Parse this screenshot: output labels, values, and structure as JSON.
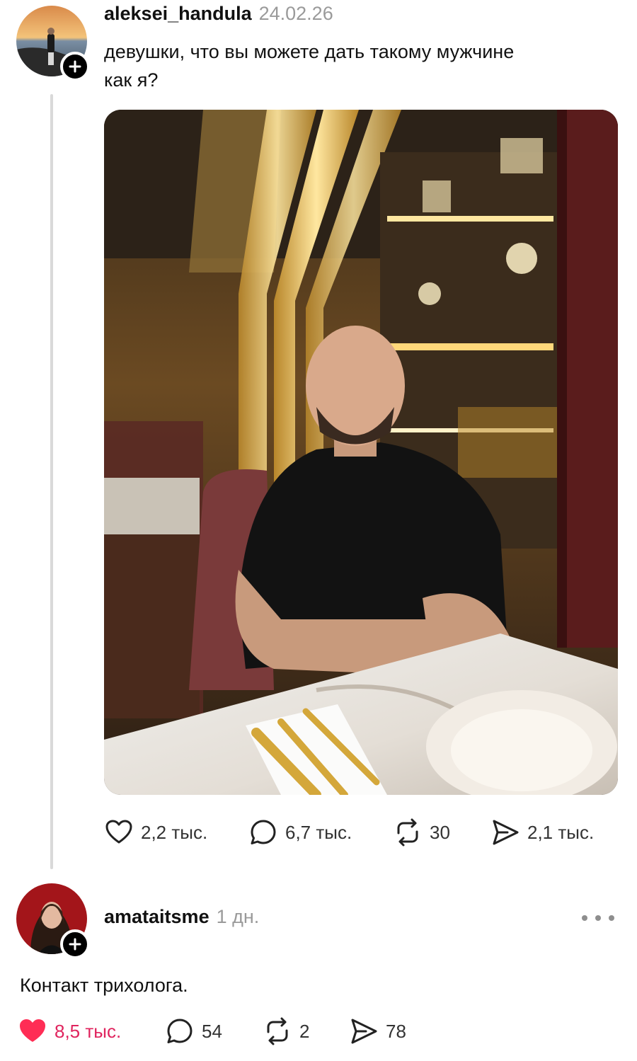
{
  "post": {
    "username": "aleksei_handula",
    "timestamp": "24.02.26",
    "text_line1": "девушки, что вы можете дать такому мужчине",
    "text_line2": "как я?",
    "stats": {
      "likes": "2,2 тыс.",
      "replies": "6,7 тыс.",
      "reposts": "30",
      "shares": "2,1 тыс."
    }
  },
  "reply": {
    "username": "amataitsme",
    "timestamp": "1 дн.",
    "text": "Контакт трихолога.",
    "liked": true,
    "stats": {
      "likes": "8,5 тыс.",
      "replies": "54",
      "reposts": "2",
      "shares": "78"
    }
  },
  "icons": {
    "like": "heart-icon",
    "reply": "speech-bubble-icon",
    "repost": "repost-arrows-icon",
    "share": "paper-plane-icon",
    "follow": "plus-icon",
    "more": "ellipsis-icon"
  },
  "colors": {
    "liked_heart": "#ff2d55",
    "muted_text": "#9a9a9a",
    "thread_line": "#d9d9d9"
  }
}
